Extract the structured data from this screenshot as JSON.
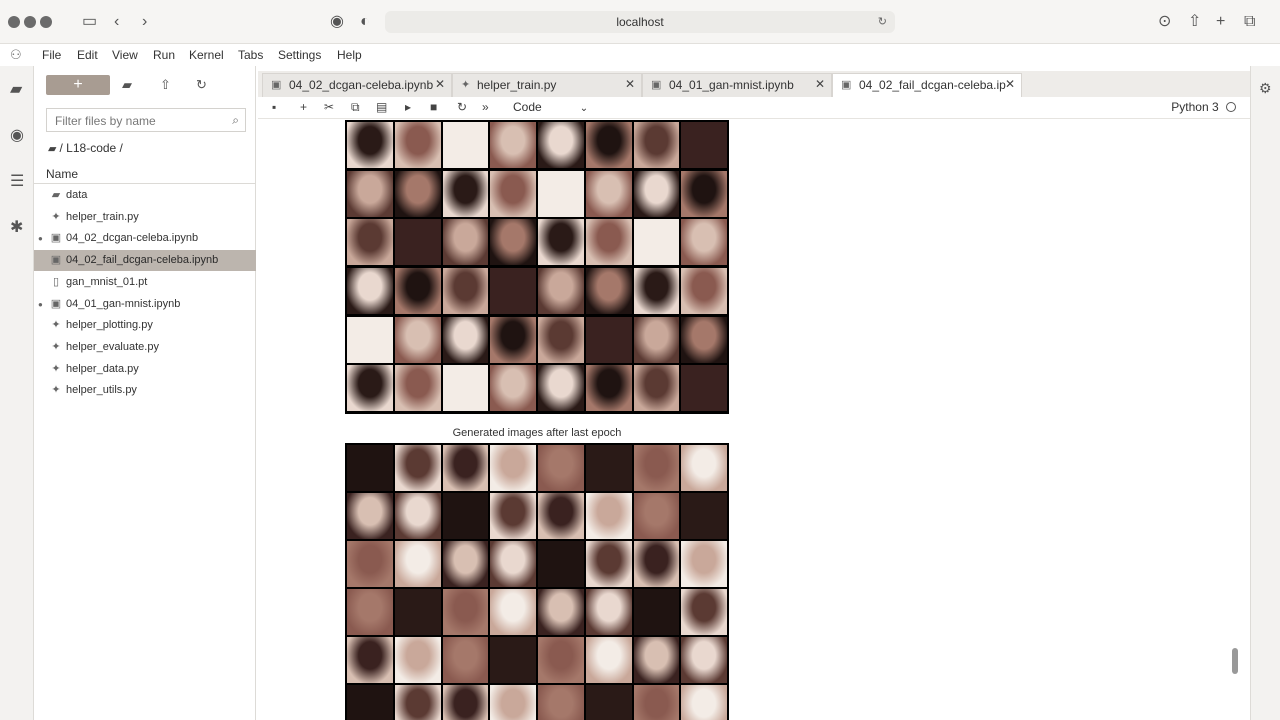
{
  "browser": {
    "url": "localhost"
  },
  "menu": [
    "File",
    "Edit",
    "View",
    "Run",
    "Kernel",
    "Tabs",
    "Settings",
    "Help"
  ],
  "filebrowser": {
    "new_label": "+",
    "filter_placeholder": "Filter files by name",
    "breadcrumb": "/ L18-code /",
    "column_name": "Name",
    "files": [
      {
        "name": "data",
        "icon": "folder-icon",
        "running": false,
        "selected": false
      },
      {
        "name": "helper_train.py",
        "icon": "python-file-icon",
        "running": false,
        "selected": false
      },
      {
        "name": "04_02_dcgan-celeba.ipynb",
        "icon": "notebook-icon",
        "running": true,
        "selected": false
      },
      {
        "name": "04_02_fail_dcgan-celeba.ipynb",
        "icon": "notebook-icon",
        "running": false,
        "selected": true
      },
      {
        "name": "gan_mnist_01.pt",
        "icon": "file-icon",
        "running": false,
        "selected": false
      },
      {
        "name": "04_01_gan-mnist.ipynb",
        "icon": "notebook-icon",
        "running": true,
        "selected": false
      },
      {
        "name": "helper_plotting.py",
        "icon": "python-file-icon",
        "running": false,
        "selected": false
      },
      {
        "name": "helper_evaluate.py",
        "icon": "python-file-icon",
        "running": false,
        "selected": false
      },
      {
        "name": "helper_data.py",
        "icon": "python-file-icon",
        "running": false,
        "selected": false
      },
      {
        "name": "helper_utils.py",
        "icon": "python-file-icon",
        "running": false,
        "selected": false
      }
    ]
  },
  "tabs": [
    {
      "label": "04_02_dcgan-celeba.ipynb",
      "active": false
    },
    {
      "label": "helper_train.py",
      "active": false
    },
    {
      "label": "04_01_gan-mnist.ipynb",
      "active": false
    },
    {
      "label": "04_02_fail_dcgan-celeba.ip",
      "active": true
    }
  ],
  "toolbar": {
    "cell_type": "Code",
    "kernel": "Python 3"
  },
  "output": {
    "caption": "Generated images after last epoch"
  },
  "colors": {
    "accent": "#a89c92",
    "selected_row": "#bcb5ae"
  }
}
